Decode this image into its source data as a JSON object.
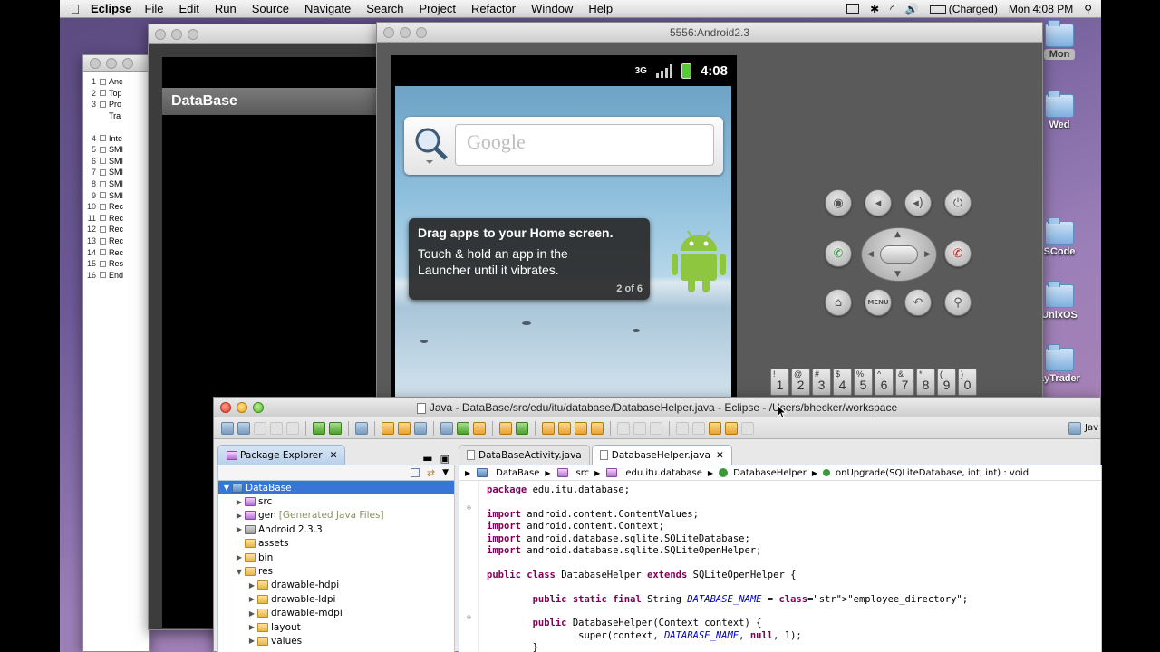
{
  "menubar": {
    "app": "Eclipse",
    "items": [
      "File",
      "Edit",
      "Run",
      "Source",
      "Navigate",
      "Search",
      "Project",
      "Refactor",
      "Window",
      "Help"
    ],
    "battery": "(Charged)",
    "clock": "Mon 4:08 PM"
  },
  "desktop": {
    "icons": [
      {
        "label": "Mon"
      },
      {
        "label": "Wed"
      },
      {
        "label": "SCode"
      },
      {
        "label": "UnixOS"
      },
      {
        "label": "ayTrader"
      }
    ]
  },
  "side_doc": {
    "lines": [
      {
        "num": "1",
        "text": "Anc"
      },
      {
        "num": "2",
        "text": "Top"
      },
      {
        "num": "3",
        "text": "Pro"
      },
      {
        "num": "",
        "text": "Tra"
      },
      {
        "num": "4",
        "text": "Inte"
      },
      {
        "num": "5",
        "text": "SMI"
      },
      {
        "num": "6",
        "text": "SMI"
      },
      {
        "num": "7",
        "text": "SMI"
      },
      {
        "num": "8",
        "text": "SMI"
      },
      {
        "num": "9",
        "text": "SMI"
      },
      {
        "num": "10",
        "text": "Rec"
      },
      {
        "num": "11",
        "text": "Rec"
      },
      {
        "num": "12",
        "text": "Rec"
      },
      {
        "num": "13",
        "text": "Rec"
      },
      {
        "num": "14",
        "text": "Rec"
      },
      {
        "num": "15",
        "text": "Res"
      },
      {
        "num": "16",
        "text": "End"
      }
    ]
  },
  "app_window": {
    "title": "DataBase"
  },
  "emulator": {
    "title": "5556:Android2.3",
    "time": "4:08",
    "network": "3G",
    "search_placeholder": "Google",
    "tip_title": "Drag apps to your Home screen.",
    "tip_line1": "Touch & hold an app in the",
    "tip_line2": "Launcher until it vibrates.",
    "tip_count": "2 of 6",
    "menu_label": "MENU",
    "keys": [
      {
        "top": "!",
        "main": "1"
      },
      {
        "top": "@",
        "main": "2"
      },
      {
        "top": "#",
        "main": "3"
      },
      {
        "top": "$",
        "main": "4"
      },
      {
        "top": "%",
        "main": "5"
      },
      {
        "top": "^",
        "main": "6"
      },
      {
        "top": "&",
        "main": "7"
      },
      {
        "top": "*",
        "main": "8"
      },
      {
        "top": "(",
        "main": "9"
      },
      {
        "top": ")",
        "main": "0"
      }
    ]
  },
  "eclipse": {
    "title": "Java - DataBase/src/edu/itu/database/DatabaseHelper.java - Eclipse - /Users/bhecker/workspace",
    "perspective": "Jav",
    "package_explorer": {
      "tab": "Package Explorer",
      "tree": [
        {
          "label": "DataBase",
          "level": 0,
          "icon": "proj",
          "open": true,
          "selected": true
        },
        {
          "label": "src",
          "level": 1,
          "icon": "pkg",
          "open": false
        },
        {
          "label": "gen",
          "note": "[Generated Java Files]",
          "level": 1,
          "icon": "pkg",
          "open": false
        },
        {
          "label": "Android 2.3.3",
          "level": 1,
          "icon": "lib",
          "open": false
        },
        {
          "label": "assets",
          "level": 1,
          "icon": "fold",
          "leaf": true
        },
        {
          "label": "bin",
          "level": 1,
          "icon": "fold",
          "open": false
        },
        {
          "label": "res",
          "level": 1,
          "icon": "fold",
          "open": true
        },
        {
          "label": "drawable-hdpi",
          "level": 2,
          "icon": "fold",
          "open": false
        },
        {
          "label": "drawable-ldpi",
          "level": 2,
          "icon": "fold",
          "open": false
        },
        {
          "label": "drawable-mdpi",
          "level": 2,
          "icon": "fold",
          "open": false
        },
        {
          "label": "layout",
          "level": 2,
          "icon": "fold",
          "open": false
        },
        {
          "label": "values",
          "level": 2,
          "icon": "fold",
          "open": false
        }
      ]
    },
    "editor_tabs": [
      {
        "label": "DataBaseActivity.java",
        "active": false
      },
      {
        "label": "DatabaseHelper.java",
        "active": true
      }
    ],
    "breadcrumb": [
      "DataBase",
      "src",
      "edu.itu.database",
      "DatabaseHelper",
      "onUpgrade(SQLiteDatabase, int, int) : void"
    ],
    "code": [
      "package edu.itu.database;",
      "",
      "import android.content.ContentValues;",
      "import android.content.Context;",
      "import android.database.sqlite.SQLiteDatabase;",
      "import android.database.sqlite.SQLiteOpenHelper;",
      "",
      "public class DatabaseHelper extends SQLiteOpenHelper {",
      "",
      "        public static final String DATABASE_NAME = \"employee_directory\";",
      "",
      "        public DatabaseHelper(Context context) {",
      "                super(context, DATABASE_NAME, null, 1);",
      "        }"
    ]
  },
  "colors": {
    "selection": "#3875d7",
    "keyword": "#7f0055",
    "string": "#2a00ff",
    "field": "#0000c0"
  }
}
